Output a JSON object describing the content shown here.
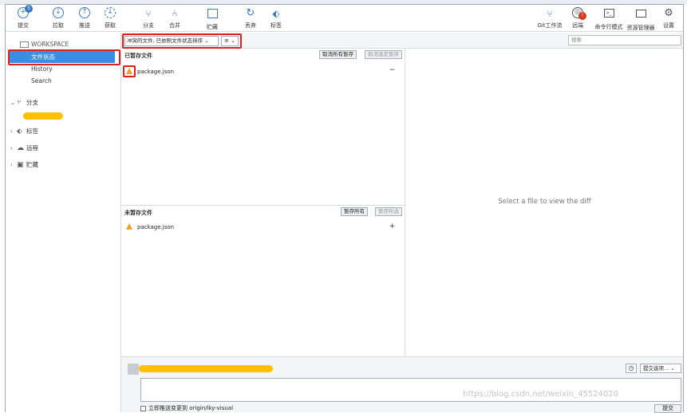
{
  "toolbar": {
    "buttons": [
      {
        "label": "提交",
        "badge": "5"
      },
      {
        "label": "拉取"
      },
      {
        "label": "推送"
      },
      {
        "label": "获取"
      },
      {
        "label": "分支"
      },
      {
        "label": "合并"
      },
      {
        "label": "贮藏"
      },
      {
        "label": "丢弃"
      },
      {
        "label": "标签"
      }
    ],
    "right_buttons": [
      {
        "label": "Git工作流"
      },
      {
        "label": "远端",
        "badge": "!"
      },
      {
        "label": "命令行模式"
      },
      {
        "label": "资源管理器"
      },
      {
        "label": "设置"
      }
    ]
  },
  "sidebar": {
    "workspace_header": "WORKSPACE",
    "file_status": "文件状态",
    "history": "History",
    "search": "Search",
    "branch": "分支",
    "tags": "标签",
    "remote": "远程",
    "stash": "贮藏"
  },
  "filterbar": {
    "filter_value": "冲突的文件, 已依照文件状态排序",
    "view_icon": "≡",
    "search_placeholder": "搜索"
  },
  "staged": {
    "title": "已暂存文件",
    "unstage_all": "取消所有暂存",
    "unstage_selected": "取消选定暂存",
    "files": [
      "package.json"
    ],
    "action": "−"
  },
  "unstaged": {
    "title": "未暂存文件",
    "stage_all": "暂存所有",
    "stage_selected": "暂存所选",
    "files": [
      "package.json"
    ],
    "action": "+"
  },
  "diff": {
    "empty_message": "Select a file to view the diff"
  },
  "commit": {
    "options_label": "提交选项...",
    "push_checkbox_label": "立即推送变更到 origin/lky-visual",
    "commit_button": "提交"
  },
  "watermark": "https://blog.csdn.net/weixin_45524020",
  "colors": {
    "accent": "#3a8ee6",
    "highlight_outline": "#e02020",
    "warning": "#f0a020",
    "redaction": "#ffc000"
  }
}
